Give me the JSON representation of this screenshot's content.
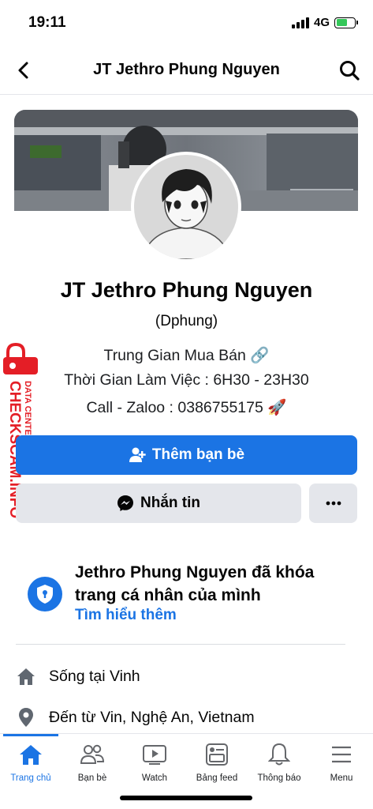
{
  "status": {
    "time": "19:11",
    "network": "4G"
  },
  "nav": {
    "title": "JT Jethro Phung Nguyen",
    "back_icon": "chevron-left-icon",
    "search_icon": "search-icon"
  },
  "profile": {
    "name": "JT Jethro Phung Nguyen",
    "alternate_name": "(Dphung)",
    "bio": [
      "Trung Gian Mua Bán 🔗",
      "Thời Gian Làm Việc : 6H30 - 23H30",
      "Call - Zaloo : 0386755175 🚀"
    ]
  },
  "watermark": {
    "line1": "DATA CENTER",
    "line2": "CHECKSCAM.INFO"
  },
  "actions": {
    "add_friend": "Thêm bạn bè",
    "message": "Nhắn tin",
    "more": "more-icon"
  },
  "locked": {
    "text": "Jethro Phung Nguyen đã khóa trang cá nhân của mình",
    "link": "Tìm hiểu thêm"
  },
  "info": [
    {
      "icon": "home-icon",
      "text": "Sống tại Vinh"
    },
    {
      "icon": "location-pin-icon",
      "text": "Đến từ Vin, Nghệ An, Vietnam"
    }
  ],
  "tabs": [
    {
      "label": "Trang chủ",
      "icon": "home-icon",
      "active": true
    },
    {
      "label": "Bạn bè",
      "icon": "friends-icon",
      "active": false
    },
    {
      "label": "Watch",
      "icon": "watch-icon",
      "active": false
    },
    {
      "label": "Bảng feed",
      "icon": "feed-icon",
      "active": false
    },
    {
      "label": "Thông báo",
      "icon": "bell-icon",
      "active": false
    },
    {
      "label": "Menu",
      "icon": "menu-icon",
      "active": false
    }
  ],
  "colors": {
    "accent": "#1b74e4",
    "button_gray": "#e4e6eb",
    "watermark_red": "#e41e26"
  }
}
